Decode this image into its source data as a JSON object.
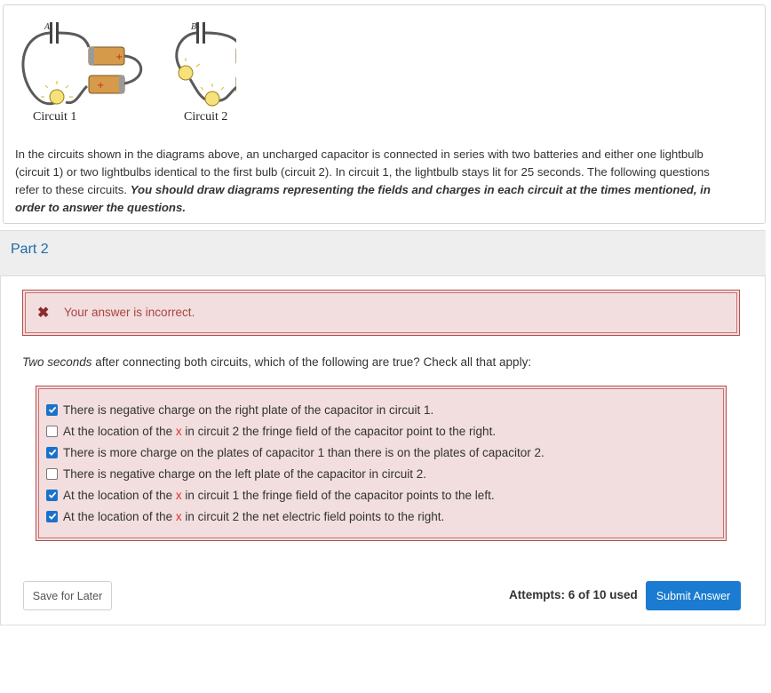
{
  "figure": {
    "caption_circuit1": "Circuit 1",
    "caption_circuit2": "Circuit 2",
    "label_a": "A",
    "label_b": "B"
  },
  "intro": {
    "text": "In the circuits shown in the diagrams above, an uncharged capacitor is connected in series with two batteries and either one lightbulb (circuit 1) or two lightbulbs identical to the first bulb (circuit 2). In circuit 1, the lightbulb stays lit for 25 seconds. The following questions refer to these circuits. ",
    "emphasis": "You should draw diagrams representing the fields and charges in each circuit at the times mentioned, in order to answer the questions."
  },
  "part": {
    "title": "Part 2"
  },
  "feedback": {
    "icon": "x-icon",
    "text": "Your answer is incorrect."
  },
  "question": {
    "italic": "Two seconds",
    "rest": " after connecting both circuits, which of the following are true? Check all that apply:"
  },
  "options": [
    {
      "pre": "There is negative charge on the right plate of the capacitor in circuit 1.",
      "x": "",
      "post": "",
      "checked": true
    },
    {
      "pre": "At the location of the ",
      "x": "x",
      "post": " in circuit 2 the fringe field of the capacitor point to the right.",
      "checked": false
    },
    {
      "pre": "There is more charge on the plates of capacitor 1 than there is on the plates of capacitor 2.",
      "x": "",
      "post": "",
      "checked": true
    },
    {
      "pre": "There is negative charge on the left plate of the capacitor in circuit 2.",
      "x": "",
      "post": "",
      "checked": false
    },
    {
      "pre": "At the location of the ",
      "x": "x",
      "post": " in circuit 1 the fringe field of the capacitor points to the left.",
      "checked": true
    },
    {
      "pre": "At the location of the ",
      "x": "x",
      "post": " in circuit 2 the net electric field points to the right.",
      "checked": true
    }
  ],
  "footer": {
    "save_label": "Save for Later",
    "attempts": "Attempts: 6 of 10 used",
    "submit_label": "Submit Answer"
  },
  "colors": {
    "link_blue": "#1e6aa9",
    "error_bg": "#f2dede",
    "error_border": "#b74b4b",
    "checkbox_blue": "#1a73c9",
    "submit_blue": "#1a7bd0",
    "x_marker_red": "#e03030"
  }
}
